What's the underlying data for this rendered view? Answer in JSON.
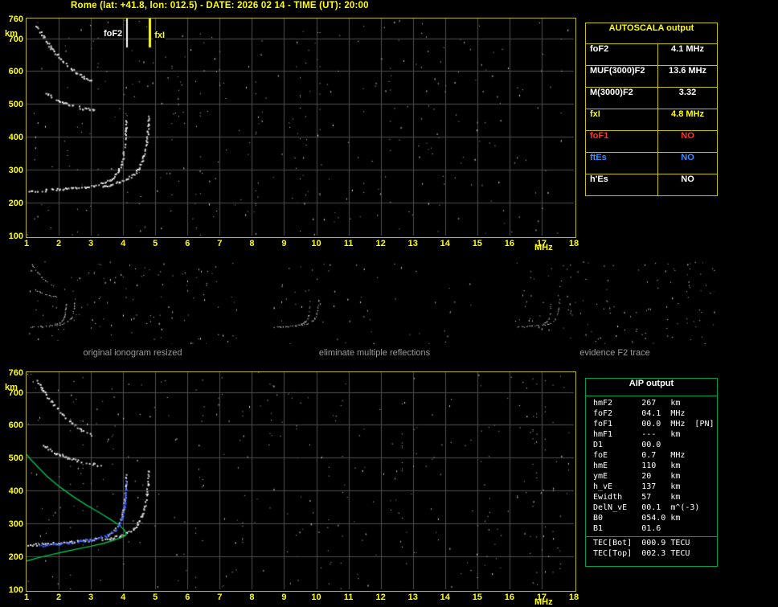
{
  "title": "Rome (lat: +41.8, lon: 012.5) - DATE: 2026 02 14 - TIME (UT): 20:00",
  "colors": {
    "accent_yellow": "#ffff00",
    "plot_border": "#b9b32a",
    "table_border_yellow": "#c8c300",
    "table_border_green": "#00a14e",
    "grid": "#4f4f4f",
    "trace_white": "#ffffff",
    "profile_green": "#00c050",
    "fit_blue": "#3a5cff",
    "status_red": "#ff3232",
    "status_blue": "#3c8cff",
    "caption_gray": "#9c9c9c"
  },
  "autoscala_table": {
    "header": "AUTOSCALA output",
    "rows": [
      {
        "label": "foF2",
        "value": "4.1 MHz",
        "color": "#ffffff"
      },
      {
        "label": "MUF(3000)F2",
        "value": "13.6 MHz",
        "color": "#ffffff"
      },
      {
        "label": "M(3000)F2",
        "value": "3.32",
        "color": "#ffffff"
      },
      {
        "label": "fxI",
        "value": "4.8 MHz",
        "color": "#ffff00"
      },
      {
        "label": "foF1",
        "value": "NO",
        "color": "#ff3232"
      },
      {
        "label": "ftEs",
        "value": "NO",
        "color": "#3c8cff"
      },
      {
        "label": "h'Es",
        "value": "NO",
        "color": "#ffffff"
      }
    ]
  },
  "aip_table": {
    "header": "AIP output",
    "rows": [
      {
        "name": "hmF2",
        "value": "267",
        "unit": "km"
      },
      {
        "name": "foF2",
        "value": "04.1",
        "unit": "MHz"
      },
      {
        "name": "foF1",
        "value": "00.0",
        "unit": "MHz  [PN]"
      },
      {
        "name": "hmF1",
        "value": "---",
        "unit": "km"
      },
      {
        "name": "D1",
        "value": "00.0",
        "unit": ""
      },
      {
        "name": "foE",
        "value": "0.7",
        "unit": "MHz"
      },
      {
        "name": "hmE",
        "value": "110",
        "unit": "km"
      },
      {
        "name": "ymE",
        "value": "20",
        "unit": "km"
      },
      {
        "name": "h_vE",
        "value": "137",
        "unit": "km"
      },
      {
        "name": "Ewidth",
        "value": "57",
        "unit": "km"
      },
      {
        "name": "DelN_vE",
        "value": "00.1",
        "unit": "m^(-3)"
      },
      {
        "name": "B0",
        "value": "054.0",
        "unit": "km"
      },
      {
        "name": "B1",
        "value": "01.6",
        "unit": ""
      }
    ],
    "tec_rows": [
      {
        "name": "TEC[Bot]",
        "value": "000.9",
        "unit": "TECU"
      },
      {
        "name": "TEC[Top]",
        "value": "002.3",
        "unit": "TECU"
      }
    ]
  },
  "thumbnails": [
    {
      "caption": "original ionogram resized"
    },
    {
      "caption": "eliminate multiple reflections"
    },
    {
      "caption": "evidence F2 trace"
    }
  ],
  "chart_data": {
    "type": "scatter",
    "x_label": "MHz",
    "y_label": "km",
    "x_range": [
      1,
      18
    ],
    "y_range": [
      100,
      760
    ],
    "x_ticks": [
      1,
      2,
      3,
      4,
      5,
      6,
      7,
      8,
      9,
      10,
      11,
      12,
      13,
      14,
      15,
      16,
      17,
      18
    ],
    "y_ticks": [
      760,
      700,
      600,
      500,
      400,
      300,
      200,
      100
    ],
    "grid": true,
    "markers": [
      {
        "name": "foF2",
        "freq": 4.1,
        "color": "#ffffff",
        "width": 2
      },
      {
        "name": "fxI",
        "freq": 4.8,
        "color": "#ffff00",
        "width": 3
      }
    ],
    "traces": {
      "f2_ordinary": [
        [
          1.05,
          236
        ],
        [
          1.3,
          238
        ],
        [
          1.6,
          240
        ],
        [
          2.0,
          242
        ],
        [
          2.4,
          245
        ],
        [
          2.8,
          249
        ],
        [
          3.1,
          254
        ],
        [
          3.35,
          261
        ],
        [
          3.55,
          270
        ],
        [
          3.72,
          282
        ],
        [
          3.85,
          298
        ],
        [
          3.94,
          320
        ],
        [
          4.0,
          348
        ],
        [
          4.04,
          382
        ],
        [
          4.07,
          418
        ],
        [
          4.09,
          452
        ]
      ],
      "f2_extraordinary": [
        [
          3.35,
          250
        ],
        [
          3.6,
          256
        ],
        [
          3.85,
          263
        ],
        [
          4.1,
          273
        ],
        [
          4.3,
          286
        ],
        [
          4.45,
          302
        ],
        [
          4.57,
          324
        ],
        [
          4.66,
          352
        ],
        [
          4.72,
          388
        ],
        [
          4.76,
          425
        ],
        [
          4.79,
          462
        ]
      ],
      "second_hop_high": [
        [
          1.3,
          738
        ],
        [
          1.5,
          706
        ],
        [
          1.75,
          672
        ],
        [
          2.05,
          638
        ],
        [
          2.4,
          606
        ],
        [
          2.75,
          583
        ],
        [
          3.05,
          568
        ]
      ],
      "second_hop_low": [
        [
          1.5,
          540
        ],
        [
          1.9,
          516
        ],
        [
          2.3,
          500
        ],
        [
          2.7,
          489
        ],
        [
          3.05,
          483
        ],
        [
          3.3,
          479
        ]
      ]
    },
    "profile_green": [
      [
        1.0,
        186
      ],
      [
        1.4,
        197
      ],
      [
        1.8,
        206
      ],
      [
        2.2,
        215
      ],
      [
        2.6,
        223
      ],
      [
        3.0,
        231
      ],
      [
        3.4,
        240
      ],
      [
        3.7,
        249
      ],
      [
        3.95,
        258
      ],
      [
        4.08,
        264
      ],
      [
        4.1,
        267
      ],
      [
        4.04,
        280
      ],
      [
        3.88,
        295
      ],
      [
        3.6,
        313
      ],
      [
        3.25,
        334
      ],
      [
        2.85,
        357
      ],
      [
        2.45,
        382
      ],
      [
        2.05,
        410
      ],
      [
        1.65,
        442
      ],
      [
        1.35,
        472
      ],
      [
        1.12,
        496
      ],
      [
        1.0,
        510
      ]
    ],
    "fit_blue": [
      [
        1.4,
        233
      ],
      [
        2.0,
        240
      ],
      [
        2.6,
        247
      ],
      [
        3.1,
        255
      ],
      [
        3.45,
        264
      ],
      [
        3.7,
        277
      ],
      [
        3.87,
        296
      ],
      [
        3.97,
        322
      ],
      [
        4.03,
        355
      ],
      [
        4.07,
        395
      ],
      [
        4.09,
        435
      ]
    ],
    "noise_seed": 20260214
  }
}
